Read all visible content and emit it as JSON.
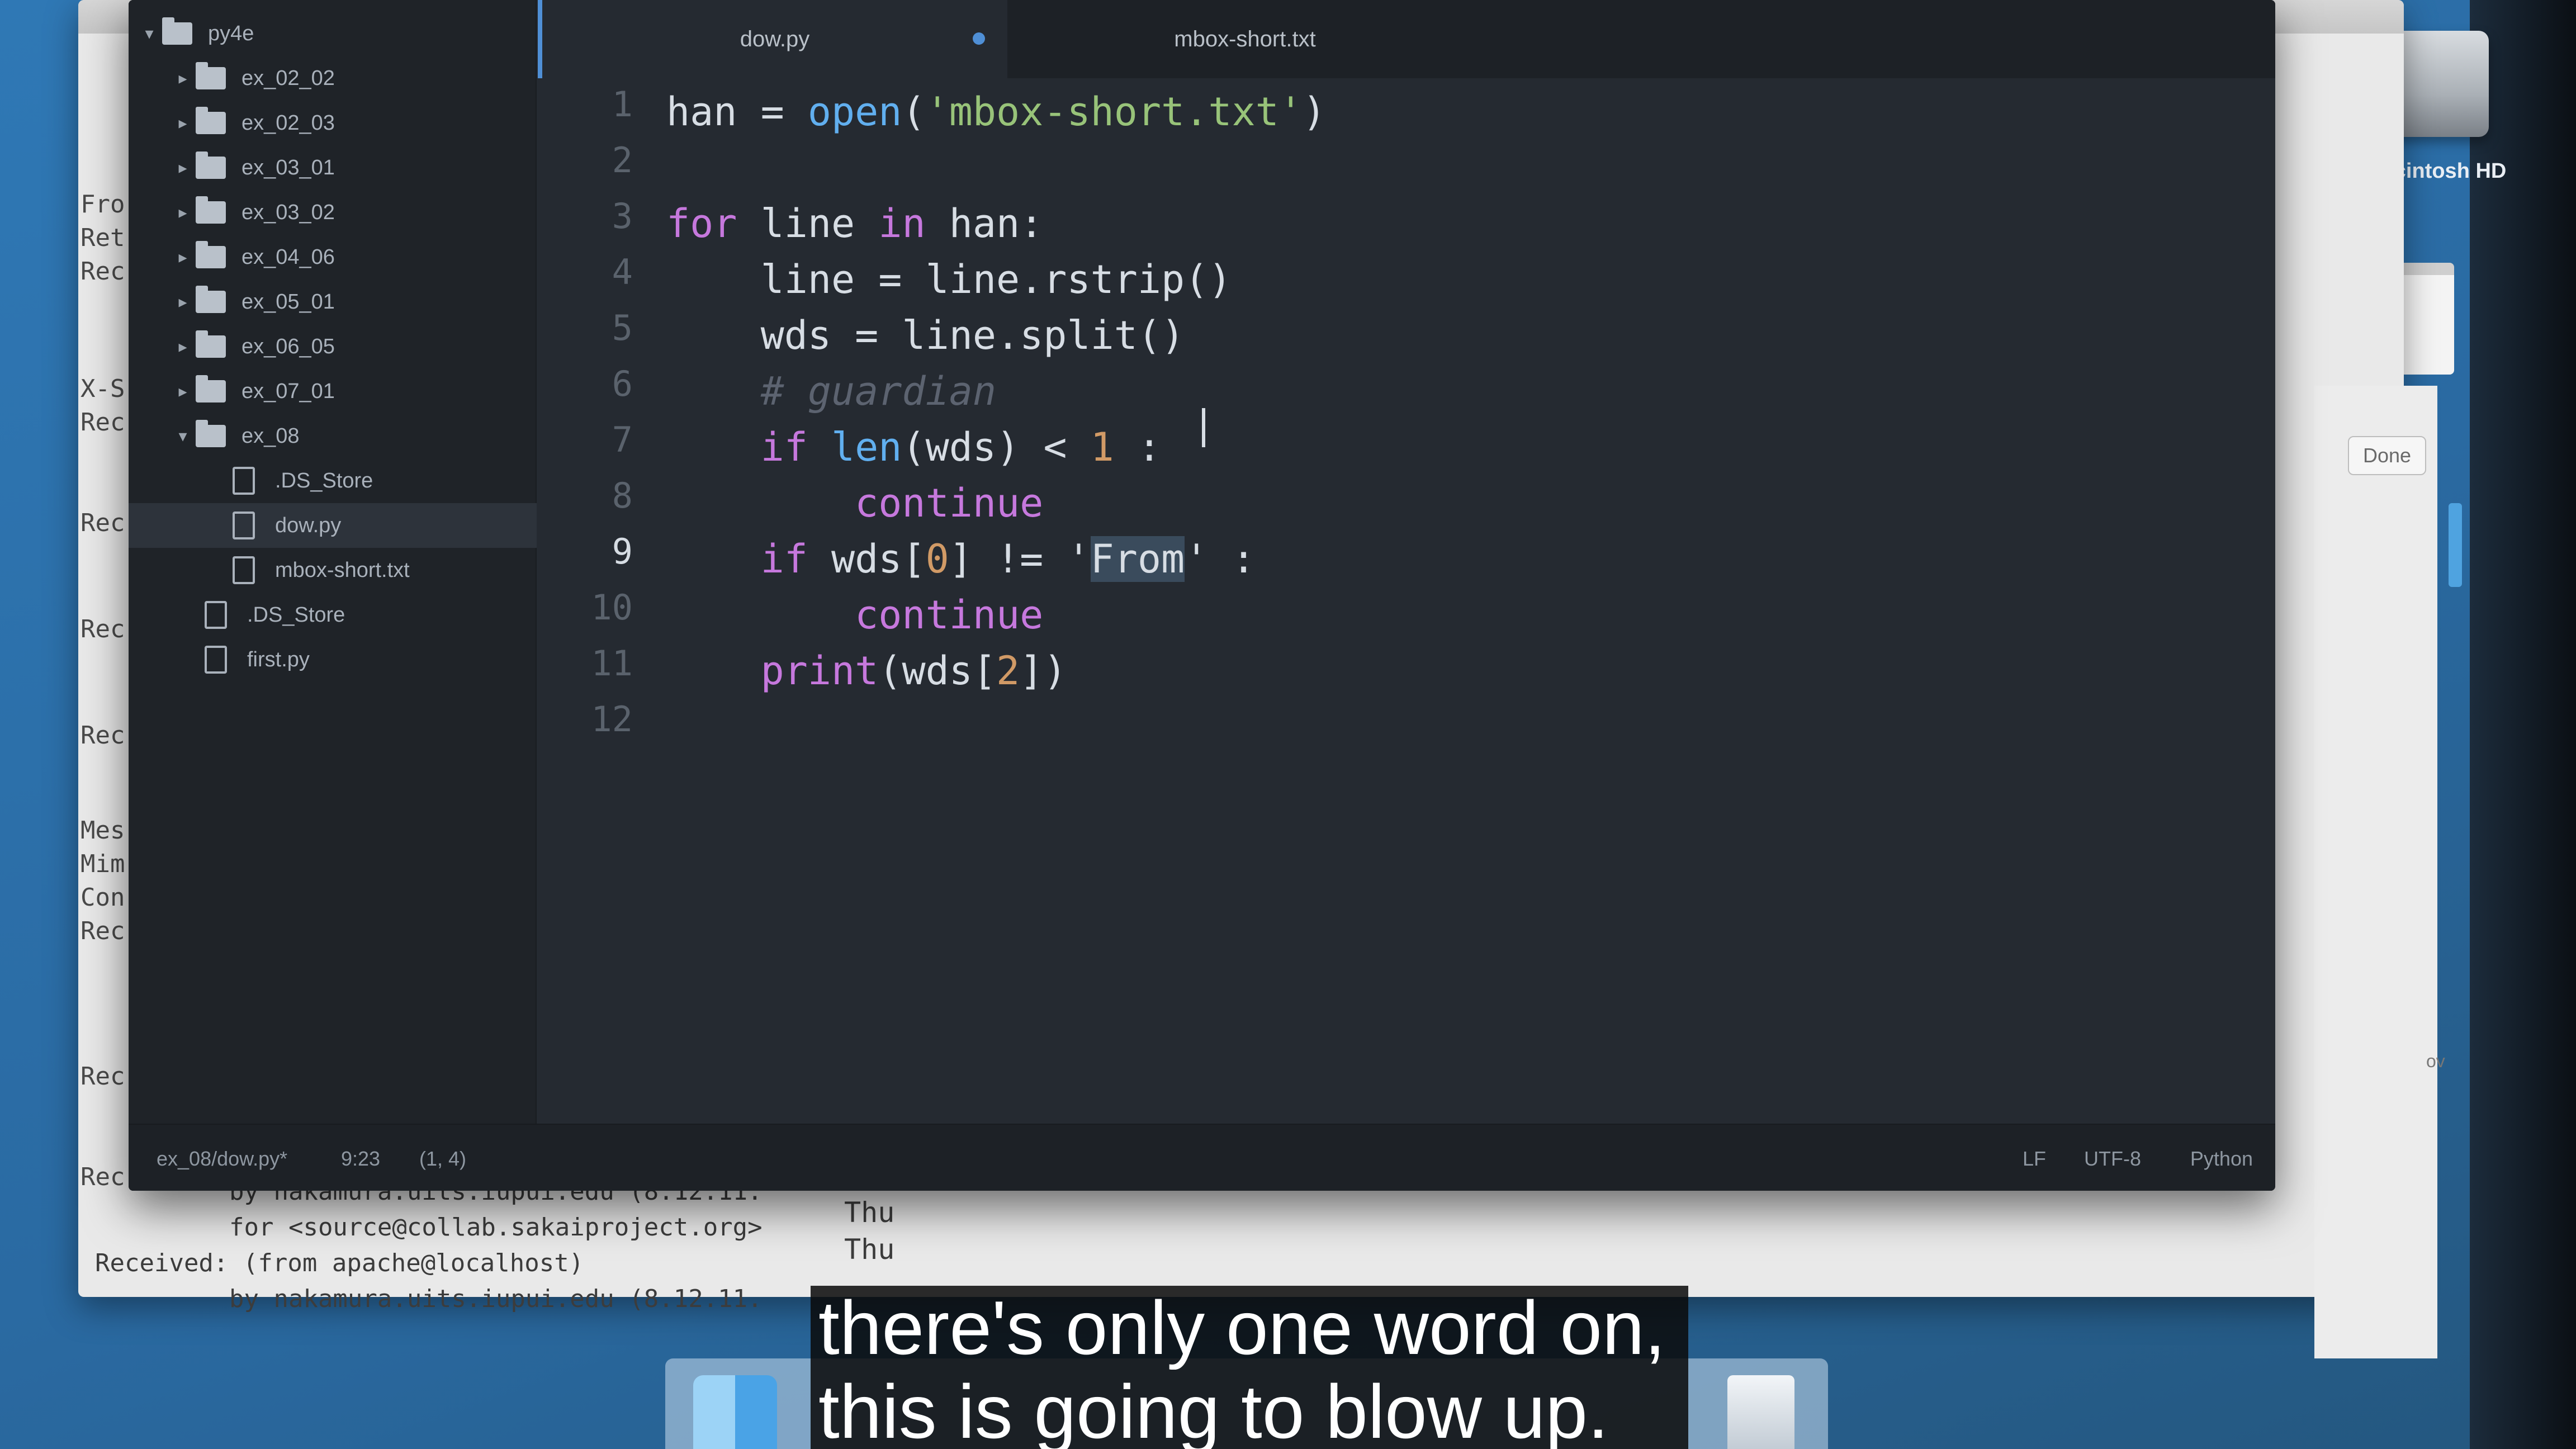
{
  "desktop": {
    "hd_label": "Macintosh HD",
    "done_label": "Done",
    "ov_fragment": "ov"
  },
  "terminal": {
    "side_fragments": [
      "Fro",
      "Ret",
      "Rec",
      "X-S",
      "Rec",
      "Rec",
      "Rec",
      "Rec",
      "Mes",
      "Mim",
      "Con",
      "Rec",
      "Rec",
      "Rec"
    ],
    "bottom_lines": [
      "by nakamura.uits.iupui.edu (8.12.11.",
      "for <source@collab.sakaiproject.org>",
      "Received: (from apache@localhost)",
      "by nakamura.uits.iupui.edu (8.12.11."
    ],
    "thu_lines": [
      "Thu",
      "Thu",
      "Thu"
    ]
  },
  "tree": {
    "root": "py4e",
    "folders": [
      "ex_02_02",
      "ex_02_03",
      "ex_03_01",
      "ex_03_02",
      "ex_04_06",
      "ex_05_01",
      "ex_06_05",
      "ex_07_01"
    ],
    "open_folder": "ex_08",
    "open_folder_files": [
      ".DS_Store",
      "dow.py",
      "mbox-short.txt"
    ],
    "root_files": [
      ".DS_Store",
      "first.py"
    ],
    "selected": "dow.py"
  },
  "tabs": {
    "active": "dow.py",
    "inactive": "mbox-short.txt"
  },
  "editor": {
    "line_numbers": [
      "1",
      "2",
      "3",
      "4",
      "5",
      "6",
      "7",
      "8",
      "9",
      "10",
      "11",
      "12"
    ],
    "current_line": "9",
    "lines": [
      {
        "n": 1,
        "tokens": [
          [
            "t",
            "han = "
          ],
          [
            "fn",
            "open"
          ],
          [
            "t",
            "("
          ],
          [
            "str",
            "'mbox-short.txt'"
          ],
          [
            "t",
            ")"
          ]
        ]
      },
      {
        "n": 2,
        "tokens": []
      },
      {
        "n": 3,
        "tokens": [
          [
            "kw",
            "for"
          ],
          [
            "t",
            " line "
          ],
          [
            "kw",
            "in"
          ],
          [
            "t",
            " han:"
          ]
        ]
      },
      {
        "n": 4,
        "tokens": [
          [
            "t",
            "    line = line.rstrip()"
          ]
        ]
      },
      {
        "n": 5,
        "tokens": [
          [
            "t",
            "    wds = line.split()"
          ]
        ]
      },
      {
        "n": 6,
        "tokens": [
          [
            "cm",
            "    # guardian"
          ]
        ]
      },
      {
        "n": 7,
        "tokens": [
          [
            "kw",
            "    if "
          ],
          [
            "fn",
            "len"
          ],
          [
            "t",
            "(wds) < "
          ],
          [
            "num",
            "1"
          ],
          [
            "t",
            " :"
          ]
        ]
      },
      {
        "n": 8,
        "tokens": [
          [
            "kw",
            "        continue"
          ]
        ]
      },
      {
        "n": 9,
        "tokens": [
          [
            "kw",
            "    if"
          ],
          [
            "t",
            " wds["
          ],
          [
            "num",
            "0"
          ],
          [
            "t",
            "] != '"
          ],
          [
            "hl",
            "From"
          ],
          [
            "t",
            "' :"
          ]
        ]
      },
      {
        "n": 10,
        "tokens": [
          [
            "kw",
            "        continue"
          ]
        ]
      },
      {
        "n": 11,
        "tokens": [
          [
            "kw",
            "    print"
          ],
          [
            "t",
            "(wds["
          ],
          [
            "num",
            "2"
          ],
          [
            "t",
            "])"
          ]
        ]
      },
      {
        "n": 12,
        "tokens": []
      }
    ]
  },
  "status": {
    "file": "ex_08/dow.py*",
    "position": "9:23",
    "selection": "(1, 4)",
    "line_ending": "LF",
    "encoding": "UTF-8",
    "grammar": "Python"
  },
  "captions": {
    "line1": "there's only one word on,",
    "line2": "this is going to blow up."
  }
}
